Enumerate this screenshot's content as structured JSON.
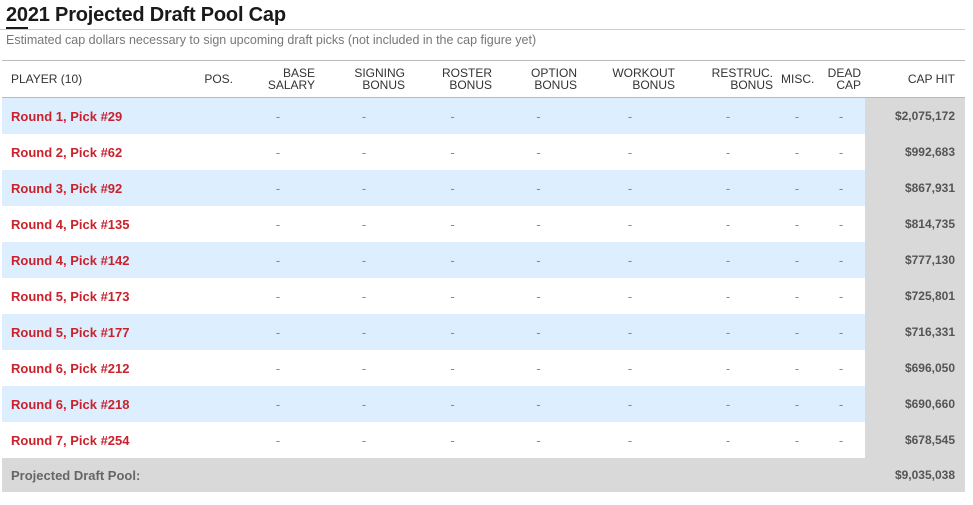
{
  "title": "2021 Projected Draft Pool Cap",
  "subtitle": "Estimated cap dollars necessary to sign upcoming draft picks (not included in the cap figure yet)",
  "columns": {
    "player": "PLAYER (10)",
    "pos": "POS.",
    "base_salary": "BASE SALARY",
    "signing_bonus": "SIGNING BONUS",
    "roster_bonus": "ROSTER BONUS",
    "option_bonus": "OPTION BONUS",
    "workout_bonus": "WORKOUT BONUS",
    "restruc_bonus": "RESTRUC. BONUS",
    "misc": "MISC.",
    "dead_cap": "DEAD CAP",
    "cap_hit": "CAP HIT"
  },
  "empty_value": "-",
  "rows": [
    {
      "player": "Round 1, Pick #29",
      "cap_hit": "$2,075,172"
    },
    {
      "player": "Round 2, Pick #62",
      "cap_hit": "$992,683"
    },
    {
      "player": "Round 3, Pick #92",
      "cap_hit": "$867,931"
    },
    {
      "player": "Round 4, Pick #135",
      "cap_hit": "$814,735"
    },
    {
      "player": "Round 4, Pick #142",
      "cap_hit": "$777,130"
    },
    {
      "player": "Round 5, Pick #173",
      "cap_hit": "$725,801"
    },
    {
      "player": "Round 5, Pick #177",
      "cap_hit": "$716,331"
    },
    {
      "player": "Round 6, Pick #212",
      "cap_hit": "$696,050"
    },
    {
      "player": "Round 6, Pick #218",
      "cap_hit": "$690,660"
    },
    {
      "player": "Round 7, Pick #254",
      "cap_hit": "$678,545"
    }
  ],
  "total": {
    "label": "Projected Draft Pool:",
    "value": "$9,035,038"
  },
  "colors": {
    "link": "#c8232c",
    "alt_row": "#ddeeff",
    "cap_hit_bg": "#d9d9d9"
  }
}
